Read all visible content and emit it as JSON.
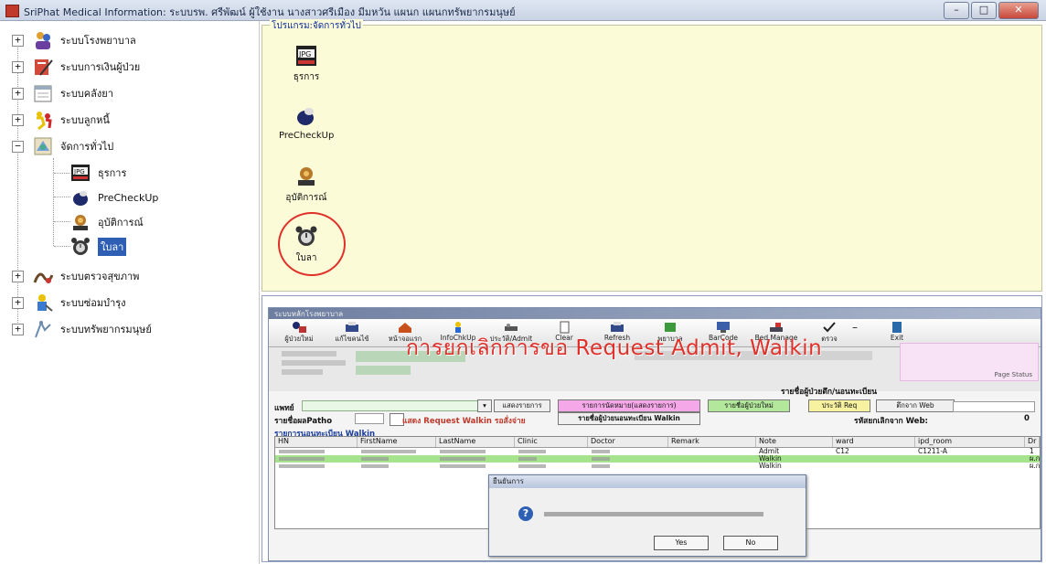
{
  "window": {
    "title": "SriPhat Medical Information: ระบบรพ. ศรีพัฒน์ ผู้ใช้งาน นางสาวศรีเมือง มีมหวัน แผนก แผนกทรัพยากรมนุษย์",
    "controls": [
      "–",
      "□",
      "✕"
    ]
  },
  "tree": {
    "items": [
      {
        "label": "ระบบโรงพยาบาล",
        "icon": "hospital-users-icon",
        "expander": "+"
      },
      {
        "label": "ระบบการเงินผู้ป่วย",
        "icon": "finance-pen-icon",
        "expander": "+"
      },
      {
        "label": "ระบบคลังยา",
        "icon": "calendar-icon",
        "expander": "+"
      },
      {
        "label": "ระบบลูกหนี้",
        "icon": "running-people-icon",
        "expander": "+"
      },
      {
        "label": "จัดการทั่วไป",
        "icon": "network-tools-icon",
        "expander": "−"
      },
      {
        "label": "ธุรการ",
        "icon": "jpg-file-icon"
      },
      {
        "label": "PreCheckUp",
        "icon": "drop-pill-icon"
      },
      {
        "label": "อุบัติการณ์",
        "icon": "siren-icon"
      },
      {
        "label": "ใบลา",
        "icon": "alarm-clock-icon",
        "selected": true
      },
      {
        "label": "ระบบตรวจสุขภาพ",
        "icon": "health-check-icon",
        "expander": "+"
      },
      {
        "label": "ระบบซ่อมบำรุง",
        "icon": "maintenance-icon",
        "expander": "+"
      },
      {
        "label": "ระบบทรัพยากรมนุษย์",
        "icon": "hr-people-icon",
        "expander": "+"
      }
    ]
  },
  "panel": {
    "legend": "โปรแกรม:จัดการทั่วไป",
    "programs": [
      {
        "label": "ธุรการ",
        "icon": "jpg-file-icon"
      },
      {
        "label": "PreCheckUp",
        "icon": "drop-pill-icon"
      },
      {
        "label": "อุบัติการณ์",
        "icon": "siren-icon"
      },
      {
        "label": "ใบลา",
        "icon": "alarm-clock-icon"
      }
    ]
  },
  "inner": {
    "title": "ระบบหลักโรงพยาบาล",
    "toolbar": [
      "ผู้ป่วยใหม่",
      "แก้ไขคนไข้",
      "หน้าจอแรก",
      "InfoChkUp",
      "ประวัติ/Admit",
      "Clear",
      "Refresh",
      "พยาบาล",
      "BarCode",
      "Bed Manage",
      "ตรวจ",
      "–",
      "Exit"
    ],
    "banner": "การยกเลิกการขอ Request Admit, Walkin",
    "pink_box_label": "Page Status",
    "labels": {
      "ward": "แพทย์",
      "history_list": "รายชื่อผู้ป่วยตึก/นอนทะเบียน",
      "patho": "รายชื่อผลPatho",
      "reqlist": "รายการนอนทะเบียน Walkin",
      "web": "ตึกจาก Web",
      "web_cancel": "รหัสยกเลิกจาก Web:",
      "web_count": "0",
      "chk_request": "แสดง Request Walkin รอสั่งจ่าย"
    },
    "buttons": {
      "search": "แสดงรายการ",
      "pink": "รายการนัดหมาย(แสดงรายการ)",
      "green": "รายชื่อผู้ป่วยใหม่",
      "refresh": "ประวัติ Req",
      "list_walkin": "รายชื่อผู้ป่วยนอนทะเบียน Walkin"
    },
    "grid": {
      "columns": [
        "HN",
        "FirstName",
        "LastName",
        "Clinic",
        "Doctor",
        "Remark",
        "Note",
        "ward",
        "ipd_room",
        "Dr"
      ],
      "rows": [
        {
          "note": "Admit",
          "ward": "C12",
          "room": "C1211-A",
          "dr": "1",
          "color": "#ffffff"
        },
        {
          "note": "Walkin",
          "ward": "",
          "room": "",
          "dr": "ผ.ก",
          "color": "#a6e38d"
        },
        {
          "note": "Walkin",
          "ward": "",
          "room": "",
          "dr": "ผ.ก",
          "color": "#ffffff"
        }
      ]
    },
    "dialog": {
      "title": "ยืนยันการ",
      "yes": "Yes",
      "no": "No"
    }
  }
}
